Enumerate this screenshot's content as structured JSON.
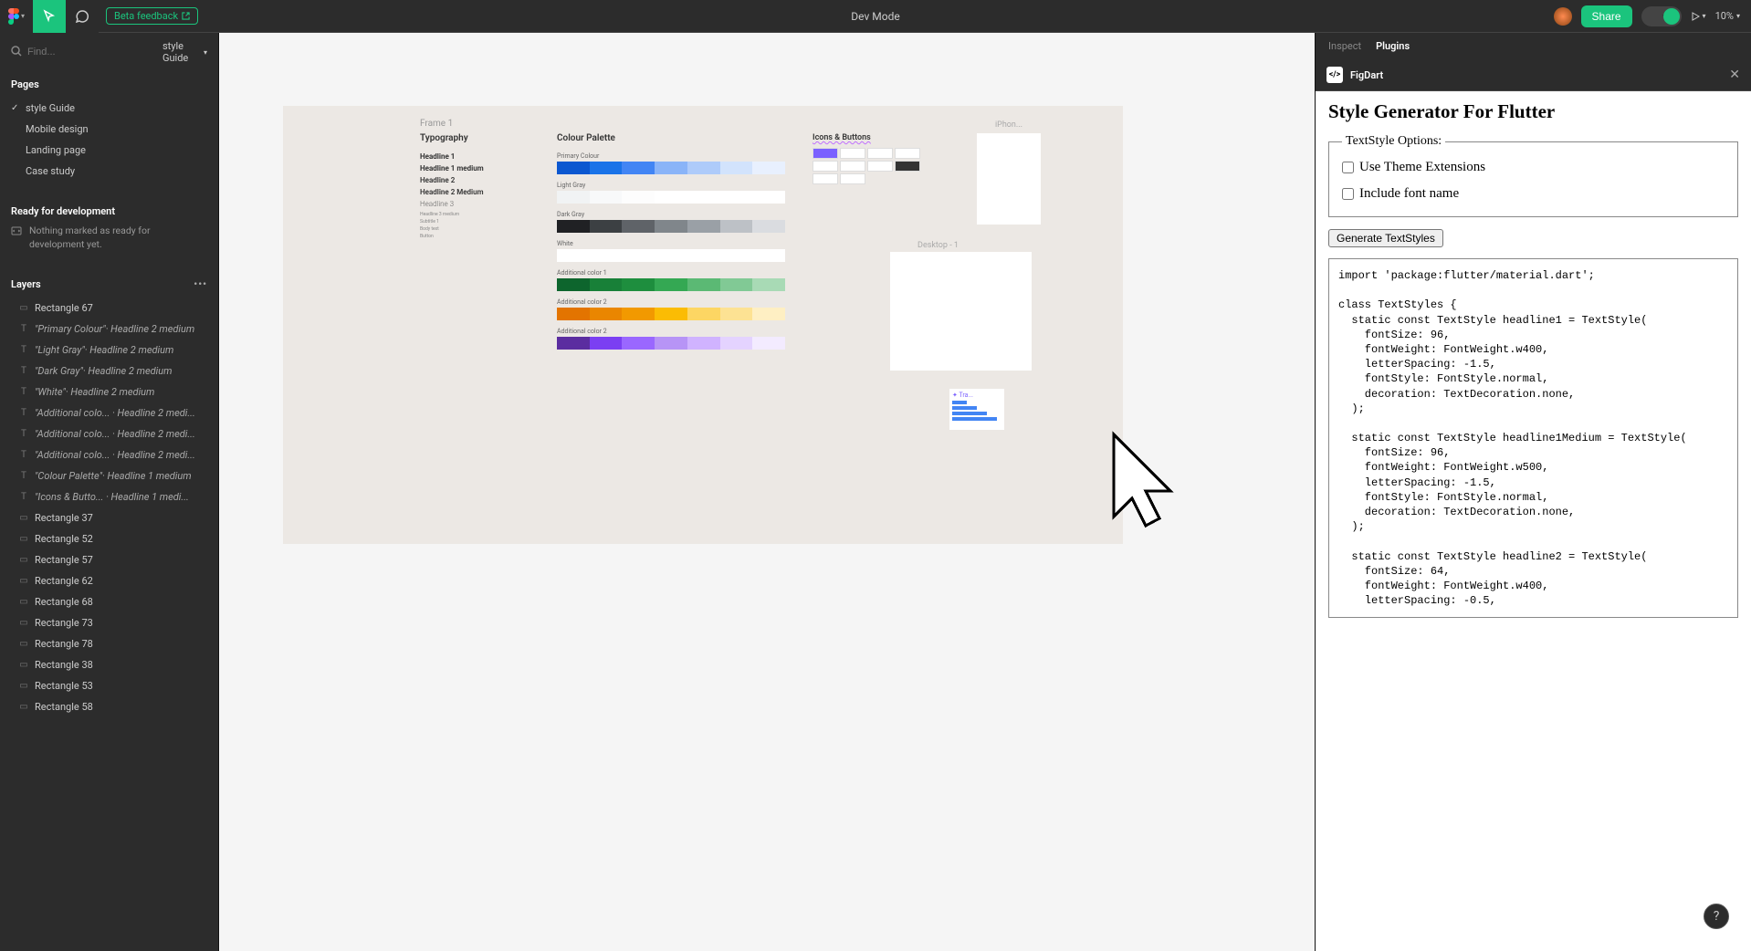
{
  "toolbar": {
    "betaLabel": "Beta feedback",
    "title": "Dev Mode",
    "share": "Share",
    "zoom": "10%"
  },
  "leftPanel": {
    "search": {
      "placeholder": "Find..."
    },
    "pageSelector": "style Guide",
    "pagesHeader": "Pages",
    "pages": [
      {
        "label": "style Guide",
        "active": true
      },
      {
        "label": "Mobile design",
        "active": false
      },
      {
        "label": "Landing page",
        "active": false
      },
      {
        "label": "Case study",
        "active": false
      }
    ],
    "readyHeader": "Ready for development",
    "readyMessage": "Nothing marked as ready for development yet.",
    "layersHeader": "Layers",
    "layers": [
      {
        "icon": "rect",
        "label": "Rectangle 67"
      },
      {
        "icon": "text",
        "label": "\"Primary Colour\"· Headline 2 medium",
        "italic": true
      },
      {
        "icon": "text",
        "label": "\"Light Gray\"· Headline 2 medium",
        "italic": true
      },
      {
        "icon": "text",
        "label": "\"Dark Gray\"· Headline 2 medium",
        "italic": true
      },
      {
        "icon": "text",
        "label": "\"White\"· Headline 2 medium",
        "italic": true
      },
      {
        "icon": "text",
        "label": "\"Additional colo... · Headline 2 medi...",
        "italic": true
      },
      {
        "icon": "text",
        "label": "\"Additional colo... · Headline 2 medi...",
        "italic": true
      },
      {
        "icon": "text",
        "label": "\"Additional colo... · Headline 2 medi...",
        "italic": true
      },
      {
        "icon": "text",
        "label": "\"Colour Palette\"· Headline 1 medium",
        "italic": true
      },
      {
        "icon": "text",
        "label": "\"Icons & Butto... · Headline 1 medi...",
        "italic": true
      },
      {
        "icon": "rect",
        "label": "Rectangle 37"
      },
      {
        "icon": "rect",
        "label": "Rectangle 52"
      },
      {
        "icon": "rect",
        "label": "Rectangle 57"
      },
      {
        "icon": "rect",
        "label": "Rectangle 62"
      },
      {
        "icon": "rect",
        "label": "Rectangle 68"
      },
      {
        "icon": "rect",
        "label": "Rectangle 73"
      },
      {
        "icon": "rect",
        "label": "Rectangle 78"
      },
      {
        "icon": "rect",
        "label": "Rectangle 38"
      },
      {
        "icon": "rect",
        "label": "Rectangle 53"
      },
      {
        "icon": "rect",
        "label": "Rectangle 58"
      }
    ]
  },
  "canvas": {
    "frameLabel": "Frame 1",
    "typography": {
      "title": "Typography",
      "rows": [
        "Headline 1",
        "Headline 1 medium",
        "Headline 2",
        "Headline 2 Medium",
        "Headline 3"
      ]
    },
    "palette": {
      "title": "Colour Palette",
      "groups": [
        {
          "label": "Primary Colour",
          "colors": [
            "#0b57d0",
            "#1a73e8",
            "#4285f4",
            "#8ab4f8",
            "#aecbfa",
            "#d2e3fc",
            "#e8f0fe"
          ]
        },
        {
          "label": "Light Gray",
          "colors": [
            "#f1f3f4",
            "#f8f9fa",
            "#fdfdfd",
            "#ffffff",
            "#ffffff",
            "#ffffff",
            "#ffffff"
          ]
        },
        {
          "label": "Dark Gray",
          "colors": [
            "#202124",
            "#3c4043",
            "#5f6368",
            "#80868b",
            "#9aa0a6",
            "#bdc1c6",
            "#dadce0"
          ]
        },
        {
          "label": "White",
          "colors": [
            "#ffffff",
            "#ffffff",
            "#ffffff",
            "#ffffff",
            "#ffffff",
            "#ffffff",
            "#ffffff"
          ]
        },
        {
          "label": "Additional color 1",
          "colors": [
            "#0d652d",
            "#188038",
            "#1e8e3e",
            "#34a853",
            "#5bb974",
            "#81c995",
            "#a8dab5"
          ]
        },
        {
          "label": "Additional color 2",
          "colors": [
            "#e37400",
            "#ea8600",
            "#f29900",
            "#fbbc04",
            "#fdd663",
            "#fde293",
            "#feefc3"
          ]
        },
        {
          "label": "Additional color 2",
          "colors": [
            "#5b2da0",
            "#7b3ff2",
            "#9a67ff",
            "#b794f6",
            "#d0b3ff",
            "#e4d3ff",
            "#f3ebff"
          ]
        }
      ]
    },
    "iconsTitle": "Icons & Buttons",
    "phoneLabel": "iPhon...",
    "desktopLabel": "Desktop - 1",
    "traLabel": "✦ Tra..."
  },
  "rightPanel": {
    "tabs": {
      "inspect": "Inspect",
      "plugins": "Plugins"
    },
    "pluginName": "FigDart",
    "pluginTitle": "Style Generator For Flutter",
    "fieldsetLegend": "TextStyle Options:",
    "checkbox1": "Use Theme Extensions",
    "checkbox2": "Include font name",
    "generateBtn": "Generate TextStyles",
    "code": "import 'package:flutter/material.dart';\n\nclass TextStyles {\n  static const TextStyle headline1 = TextStyle(\n    fontSize: 96,\n    fontWeight: FontWeight.w400,\n    letterSpacing: -1.5,\n    fontStyle: FontStyle.normal,\n    decoration: TextDecoration.none,\n  );\n\n  static const TextStyle headline1Medium = TextStyle(\n    fontSize: 96,\n    fontWeight: FontWeight.w500,\n    letterSpacing: -1.5,\n    fontStyle: FontStyle.normal,\n    decoration: TextDecoration.none,\n  );\n\n  static const TextStyle headline2 = TextStyle(\n    fontSize: 64,\n    fontWeight: FontWeight.w400,\n    letterSpacing: -0.5,"
  },
  "helpFab": "?"
}
